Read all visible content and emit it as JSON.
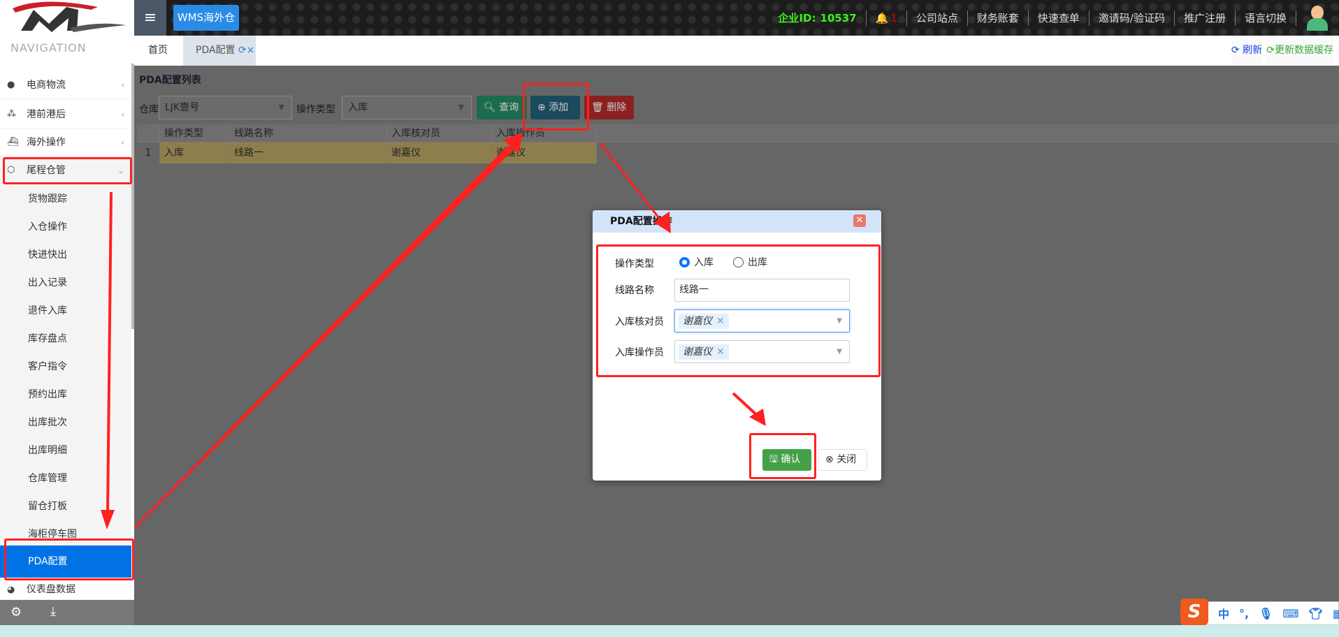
{
  "header": {
    "menu_icon": "hamburger-icon",
    "app_button": "WMS海外仓",
    "company_id_label": "企业ID:",
    "company_id": "10537",
    "notification_count": "1",
    "links": [
      "公司站点",
      "财务账套",
      "快速查单",
      "邀请码/验证码",
      "推广注册",
      "语言切换"
    ]
  },
  "tabs": [
    {
      "label": "首页"
    },
    {
      "label": "PDA配置",
      "refresh_icon": "refresh-icon",
      "close": "×"
    }
  ],
  "tab_actions": {
    "refresh": "刷新",
    "update_cache": "更新数据缓存"
  },
  "sidebar": {
    "title": "NAVIGATION",
    "groups": [
      {
        "label": "电商物流",
        "icon": "globe-icon"
      },
      {
        "label": "港前港后",
        "icon": "cubes-icon"
      },
      {
        "label": "海外操作",
        "icon": "ship-icon"
      },
      {
        "label": "尾程仓管",
        "icon": "box-icon"
      }
    ],
    "sub_items": [
      "货物跟踪",
      "入仓操作",
      "快进快出",
      "出入记录",
      "退件入库",
      "库存盘点",
      "客户指令",
      "预约出库",
      "出库批次",
      "出库明细",
      "仓库管理",
      "留仓打板",
      "海柜停车图",
      "PDA配置"
    ],
    "active": "PDA配置",
    "next_group": "仪表盘数据"
  },
  "panel": {
    "title": "PDA配置列表",
    "warehouse_label": "仓库",
    "warehouse_value": "LJK壹号",
    "optype_label": "操作类型",
    "optype_value": "入库",
    "query": "查询",
    "add": "添加",
    "delete": "删除",
    "columns": [
      "操作类型",
      "线路名称",
      "入库核对员",
      "入库操作员"
    ],
    "rows": [
      {
        "num": "1",
        "optype": "入库",
        "route": "线路一",
        "checker": "谢嘉仪",
        "operator": "谢嘉仪"
      }
    ]
  },
  "dialog": {
    "title": "PDA配置操作",
    "optype_label": "操作类型",
    "opt_in": "入库",
    "opt_out": "出库",
    "selected": "入库",
    "route_label": "线路名称",
    "route_value": "线路一",
    "checker_label": "入库核对员",
    "checker_tag": "谢嘉仪",
    "operator_label": "入库操作员",
    "operator_tag": "谢嘉仪",
    "confirm": "确认",
    "close": "关闭"
  },
  "ime": {
    "lang": "中",
    "punct": "°,"
  },
  "colors": {
    "accent": "#0072e6",
    "annotation": "#ff2020",
    "confirm": "#43a047",
    "company_id": "#3cf01e"
  }
}
